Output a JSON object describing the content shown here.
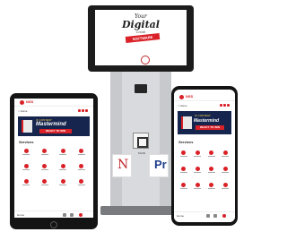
{
  "kiosk": {
    "logo_line1": "Your",
    "logo_line2": "Digital",
    "logo_line3": "Credit",
    "banner": "SOFTWARE",
    "badge_left": "N",
    "badge_right": "Pr",
    "qr_label": "SCAN"
  },
  "tablet_app": {
    "brand": "NSS",
    "back_label": "< Home",
    "promo_title": "Mastermind",
    "promo_sub": "READY TO WIN",
    "promo_tag": "★ CONTEST",
    "section_title": "Services",
    "nav_label": "Home"
  },
  "phone_app": {
    "brand": "NSS",
    "back_label": "< Home",
    "promo_title": "Mastermind",
    "promo_sub": "READY TO WIN",
    "promo_tag": "★ CONTEST",
    "section_title": "Services",
    "nav_label": "Home"
  },
  "colors": {
    "accent": "#d92127",
    "promo_bg": "#16254d",
    "kiosk_body": "#c8c9cd"
  }
}
